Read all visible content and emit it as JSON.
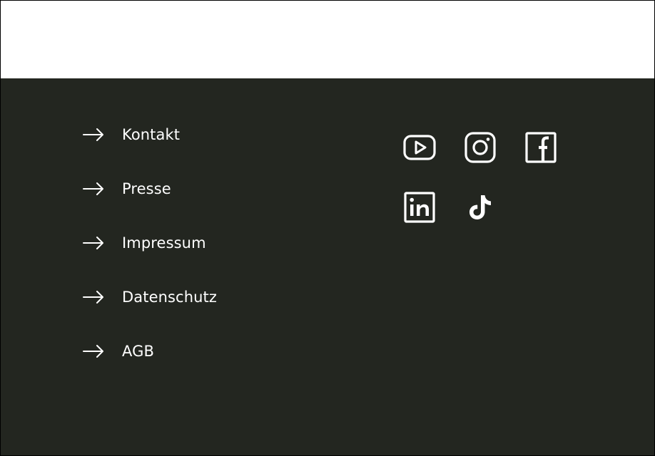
{
  "footer": {
    "links": [
      {
        "label": "Kontakt"
      },
      {
        "label": "Presse"
      },
      {
        "label": "Impressum"
      },
      {
        "label": "Datenschutz"
      },
      {
        "label": "AGB"
      }
    ],
    "social": [
      {
        "icon": "youtube-icon"
      },
      {
        "icon": "instagram-icon"
      },
      {
        "icon": "facebook-icon"
      },
      {
        "icon": "linkedin-icon"
      },
      {
        "icon": "tiktok-icon"
      }
    ]
  },
  "colors": {
    "footer_background": "#232620",
    "text": "#ffffff",
    "top_background": "#ffffff"
  }
}
